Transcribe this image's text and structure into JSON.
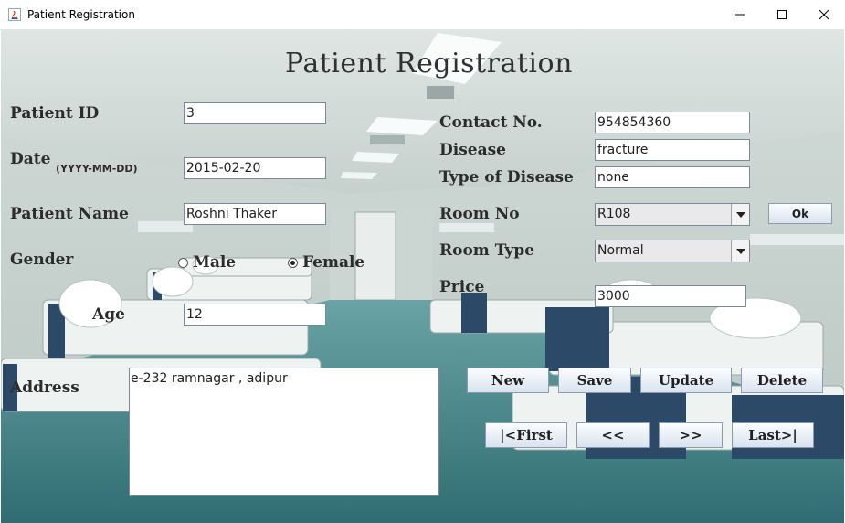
{
  "window": {
    "title": "Patient Registration",
    "controls": [
      "minimize",
      "maximize",
      "close"
    ]
  },
  "form": {
    "heading": "Patient Registration",
    "labels": {
      "patient_id": "Patient ID",
      "date": "Date",
      "date_format": "(YYYY-MM-DD)",
      "patient_name": "Patient Name",
      "gender": "Gender",
      "age": "Age",
      "address": "Address",
      "contact_no": "Contact No.",
      "disease": "Disease",
      "type_of_disease": "Type of Disease",
      "room_no": "Room No",
      "room_type": "Room Type",
      "price": "Price"
    },
    "values": {
      "patient_id": "3",
      "date": "2015-02-20",
      "patient_name": "Roshni Thaker",
      "age": "12",
      "address": "e-232 ramnagar , adipur",
      "contact_no": "954854360",
      "disease": "fracture",
      "type_of_disease": "none",
      "room_no": "R108",
      "room_type": "Normal",
      "price": "3000"
    },
    "gender_options": {
      "male": "Male",
      "female": "Female",
      "selected": "Female"
    },
    "buttons": {
      "ok": "Ok",
      "new": "New",
      "save": "Save",
      "update": "Update",
      "delete": "Delete",
      "first": "|<First",
      "prev": "<<",
      "next": ">>",
      "last": "Last>|"
    }
  },
  "colors": {
    "label_text": "#2c2c2c",
    "field_border": "#7a8a9a",
    "button_bg": "#e3ebf3",
    "floor": "#3f7f83"
  }
}
